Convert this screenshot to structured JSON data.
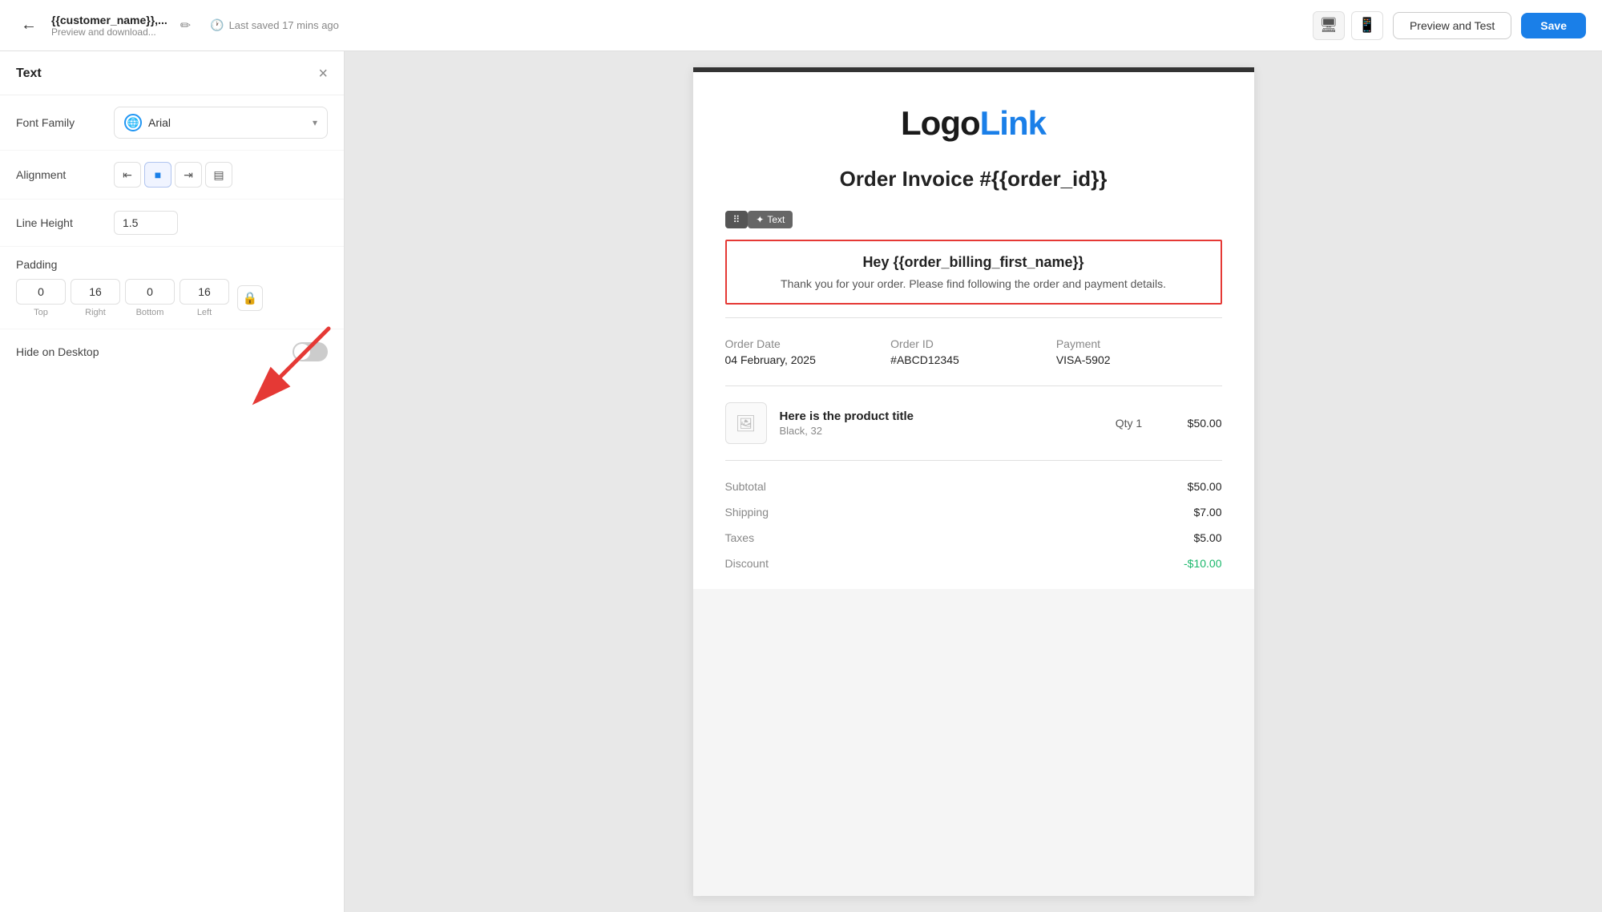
{
  "header": {
    "back_label": "←",
    "title": "{{customer_name}},...",
    "subtitle": "Preview and download...",
    "edit_icon": "✏",
    "save_info": "Last saved 17 mins ago",
    "preview_label": "Preview and Test",
    "save_label": "Save"
  },
  "devices": {
    "desktop_icon": "🖥",
    "mobile_icon": "📱"
  },
  "panel": {
    "title": "Text",
    "close_icon": "×",
    "font_family_label": "Font Family",
    "font_name": "Arial",
    "alignment_label": "Alignment",
    "align_icons": [
      "≡",
      "≡",
      "≡",
      "≡"
    ],
    "line_height_label": "Line Height",
    "line_height_value": "1.5",
    "padding_label": "Padding",
    "padding_top": "0",
    "padding_right": "16",
    "padding_bottom": "0",
    "padding_left": "16",
    "padding_top_label": "Top",
    "padding_right_label": "Right",
    "padding_bottom_label": "Bottom",
    "padding_left_label": "Left",
    "hide_desktop_label": "Hide on Desktop"
  },
  "email": {
    "logo_black": "Logo",
    "logo_blue": "Link",
    "invoice_title": "Order Invoice #{{order_id}}",
    "text_block": {
      "heading": "Hey {{order_billing_first_name}}",
      "body": "Thank you for your order. Please find following the order and payment details."
    },
    "order": {
      "date_label": "Order Date",
      "date_value": "04 February, 2025",
      "id_label": "Order ID",
      "id_value": "#ABCD12345",
      "payment_label": "Payment",
      "payment_value": "VISA-5902"
    },
    "product": {
      "title": "Here is the product title",
      "variant": "Black, 32",
      "qty_label": "Qty 1",
      "price": "$50.00"
    },
    "summary": {
      "subtotal_label": "Subtotal",
      "subtotal_value": "$50.00",
      "shipping_label": "Shipping",
      "shipping_value": "$7.00",
      "taxes_label": "Taxes",
      "taxes_value": "$5.00",
      "discount_label": "Discount",
      "discount_value": "-$10.00"
    }
  },
  "toolbar": {
    "move_icon": "⠿",
    "text_label": "Text"
  }
}
